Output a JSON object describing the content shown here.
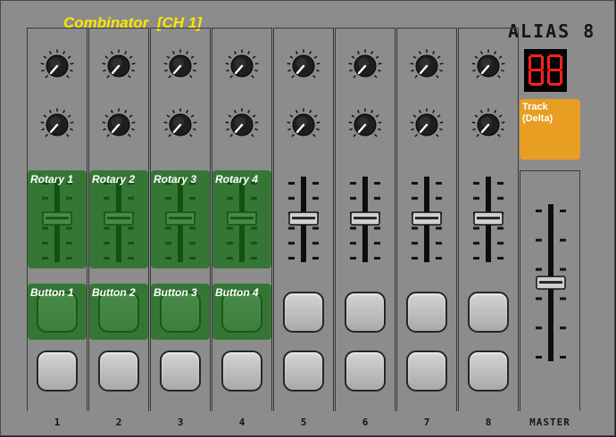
{
  "header": {
    "title": "Combinator  [CH 1]",
    "brand": "ALIAS 8"
  },
  "display": {
    "value": "88"
  },
  "track_button": {
    "label": "Track\n(Delta)",
    "color": "#e89d23"
  },
  "mappings": {
    "rotary": [
      "Rotary 1",
      "Rotary 2",
      "Rotary 3",
      "Rotary 4"
    ],
    "button": [
      "Button 1",
      "Button 2",
      "Button 3",
      "Button 4"
    ]
  },
  "channels": [
    "1",
    "2",
    "3",
    "4",
    "5",
    "6",
    "7",
    "8"
  ],
  "master_label": "MASTER",
  "colors": {
    "overlay_green": "#146e14",
    "title_yellow": "#ffe600",
    "display_red": "#ff2020"
  }
}
